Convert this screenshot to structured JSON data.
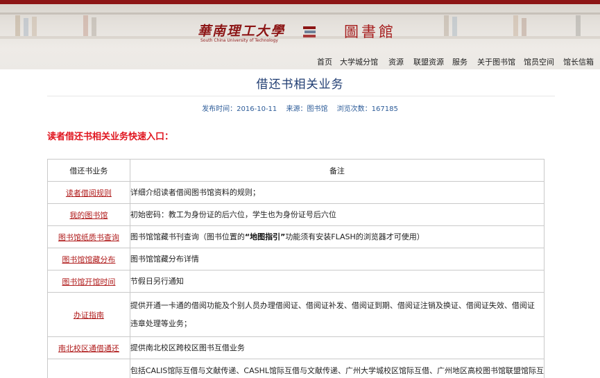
{
  "header": {
    "university_cn": "華南理工大學",
    "university_en": "South China University of Technology",
    "library_name": "圖書館",
    "accent_color": "#8c1515",
    "nav": [
      "首页",
      "大学城分馆",
      "资源",
      "联盟资源",
      "服务",
      "关于图书馆",
      "馆员空间",
      "馆长信箱"
    ]
  },
  "article": {
    "title": "借还书相关业务",
    "publish_label": "发布时间：",
    "publish_date": "2016-10-11",
    "source_label": "来源：",
    "source": "图书馆",
    "views_label": "浏览次数：",
    "views": "167185",
    "section_heading": "读者借还书相关业务快速入口："
  },
  "table": {
    "headers": [
      "借还书业务",
      "备注"
    ],
    "rows": [
      {
        "link": "读者借阅规则",
        "note": "详细介绍读者借阅图书馆资料的规则；"
      },
      {
        "link": "我的图书馆",
        "note": "初始密码：教工为身份证的后六位，学生也为身份证号后六位"
      },
      {
        "link": "图书馆纸质书查询",
        "note_pre": "图书馆馆藏书刊查询（图书位置的",
        "note_bold": "“地图指引”",
        "note_post": "功能须有安装FLASH的浏览器才可使用）"
      },
      {
        "link": "图书馆馆藏分布",
        "note": "图书馆馆藏分布详情"
      },
      {
        "link": "图书馆开馆时间",
        "note": "节假日另行通知"
      },
      {
        "link": "办证指南",
        "note_line1": "提供开通一卡通的借阅功能及个别人员办理借阅证、借阅证补发、借阅证到期、借阅证注销及换证、借阅证失效、借阅证",
        "note_line2": "违章处理等业务；"
      },
      {
        "link": "南北校区通借通还",
        "note": "提供南北校区跨校区图书互借业务"
      },
      {
        "link": "",
        "note": "包括CALIS馆际互借与文献传递、CASHL馆际互借与文献传递、广州大学城校区馆际互借、广州地区高校图书馆联盟馆际互"
      }
    ]
  }
}
